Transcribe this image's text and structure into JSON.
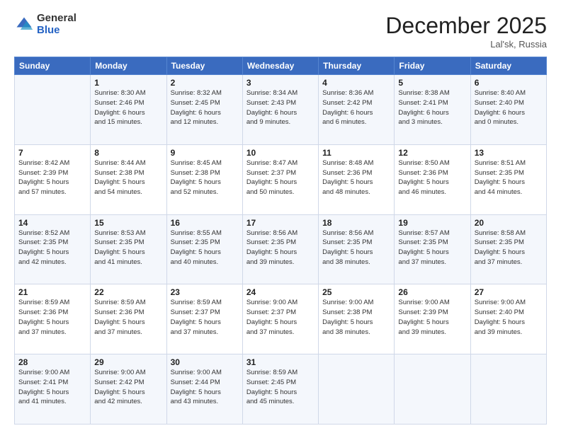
{
  "header": {
    "logo_general": "General",
    "logo_blue": "Blue",
    "month_title": "December 2025",
    "location": "Lal'sk, Russia"
  },
  "days_of_week": [
    "Sunday",
    "Monday",
    "Tuesday",
    "Wednesday",
    "Thursday",
    "Friday",
    "Saturday"
  ],
  "weeks": [
    [
      {
        "day": "",
        "info": ""
      },
      {
        "day": "1",
        "info": "Sunrise: 8:30 AM\nSunset: 2:46 PM\nDaylight: 6 hours\nand 15 minutes."
      },
      {
        "day": "2",
        "info": "Sunrise: 8:32 AM\nSunset: 2:45 PM\nDaylight: 6 hours\nand 12 minutes."
      },
      {
        "day": "3",
        "info": "Sunrise: 8:34 AM\nSunset: 2:43 PM\nDaylight: 6 hours\nand 9 minutes."
      },
      {
        "day": "4",
        "info": "Sunrise: 8:36 AM\nSunset: 2:42 PM\nDaylight: 6 hours\nand 6 minutes."
      },
      {
        "day": "5",
        "info": "Sunrise: 8:38 AM\nSunset: 2:41 PM\nDaylight: 6 hours\nand 3 minutes."
      },
      {
        "day": "6",
        "info": "Sunrise: 8:40 AM\nSunset: 2:40 PM\nDaylight: 6 hours\nand 0 minutes."
      }
    ],
    [
      {
        "day": "7",
        "info": "Sunrise: 8:42 AM\nSunset: 2:39 PM\nDaylight: 5 hours\nand 57 minutes."
      },
      {
        "day": "8",
        "info": "Sunrise: 8:44 AM\nSunset: 2:38 PM\nDaylight: 5 hours\nand 54 minutes."
      },
      {
        "day": "9",
        "info": "Sunrise: 8:45 AM\nSunset: 2:38 PM\nDaylight: 5 hours\nand 52 minutes."
      },
      {
        "day": "10",
        "info": "Sunrise: 8:47 AM\nSunset: 2:37 PM\nDaylight: 5 hours\nand 50 minutes."
      },
      {
        "day": "11",
        "info": "Sunrise: 8:48 AM\nSunset: 2:36 PM\nDaylight: 5 hours\nand 48 minutes."
      },
      {
        "day": "12",
        "info": "Sunrise: 8:50 AM\nSunset: 2:36 PM\nDaylight: 5 hours\nand 46 minutes."
      },
      {
        "day": "13",
        "info": "Sunrise: 8:51 AM\nSunset: 2:35 PM\nDaylight: 5 hours\nand 44 minutes."
      }
    ],
    [
      {
        "day": "14",
        "info": "Sunrise: 8:52 AM\nSunset: 2:35 PM\nDaylight: 5 hours\nand 42 minutes."
      },
      {
        "day": "15",
        "info": "Sunrise: 8:53 AM\nSunset: 2:35 PM\nDaylight: 5 hours\nand 41 minutes."
      },
      {
        "day": "16",
        "info": "Sunrise: 8:55 AM\nSunset: 2:35 PM\nDaylight: 5 hours\nand 40 minutes."
      },
      {
        "day": "17",
        "info": "Sunrise: 8:56 AM\nSunset: 2:35 PM\nDaylight: 5 hours\nand 39 minutes."
      },
      {
        "day": "18",
        "info": "Sunrise: 8:56 AM\nSunset: 2:35 PM\nDaylight: 5 hours\nand 38 minutes."
      },
      {
        "day": "19",
        "info": "Sunrise: 8:57 AM\nSunset: 2:35 PM\nDaylight: 5 hours\nand 37 minutes."
      },
      {
        "day": "20",
        "info": "Sunrise: 8:58 AM\nSunset: 2:35 PM\nDaylight: 5 hours\nand 37 minutes."
      }
    ],
    [
      {
        "day": "21",
        "info": "Sunrise: 8:59 AM\nSunset: 2:36 PM\nDaylight: 5 hours\nand 37 minutes."
      },
      {
        "day": "22",
        "info": "Sunrise: 8:59 AM\nSunset: 2:36 PM\nDaylight: 5 hours\nand 37 minutes."
      },
      {
        "day": "23",
        "info": "Sunrise: 8:59 AM\nSunset: 2:37 PM\nDaylight: 5 hours\nand 37 minutes."
      },
      {
        "day": "24",
        "info": "Sunrise: 9:00 AM\nSunset: 2:37 PM\nDaylight: 5 hours\nand 37 minutes."
      },
      {
        "day": "25",
        "info": "Sunrise: 9:00 AM\nSunset: 2:38 PM\nDaylight: 5 hours\nand 38 minutes."
      },
      {
        "day": "26",
        "info": "Sunrise: 9:00 AM\nSunset: 2:39 PM\nDaylight: 5 hours\nand 39 minutes."
      },
      {
        "day": "27",
        "info": "Sunrise: 9:00 AM\nSunset: 2:40 PM\nDaylight: 5 hours\nand 39 minutes."
      }
    ],
    [
      {
        "day": "28",
        "info": "Sunrise: 9:00 AM\nSunset: 2:41 PM\nDaylight: 5 hours\nand 41 minutes."
      },
      {
        "day": "29",
        "info": "Sunrise: 9:00 AM\nSunset: 2:42 PM\nDaylight: 5 hours\nand 42 minutes."
      },
      {
        "day": "30",
        "info": "Sunrise: 9:00 AM\nSunset: 2:44 PM\nDaylight: 5 hours\nand 43 minutes."
      },
      {
        "day": "31",
        "info": "Sunrise: 8:59 AM\nSunset: 2:45 PM\nDaylight: 5 hours\nand 45 minutes."
      },
      {
        "day": "",
        "info": ""
      },
      {
        "day": "",
        "info": ""
      },
      {
        "day": "",
        "info": ""
      }
    ]
  ]
}
